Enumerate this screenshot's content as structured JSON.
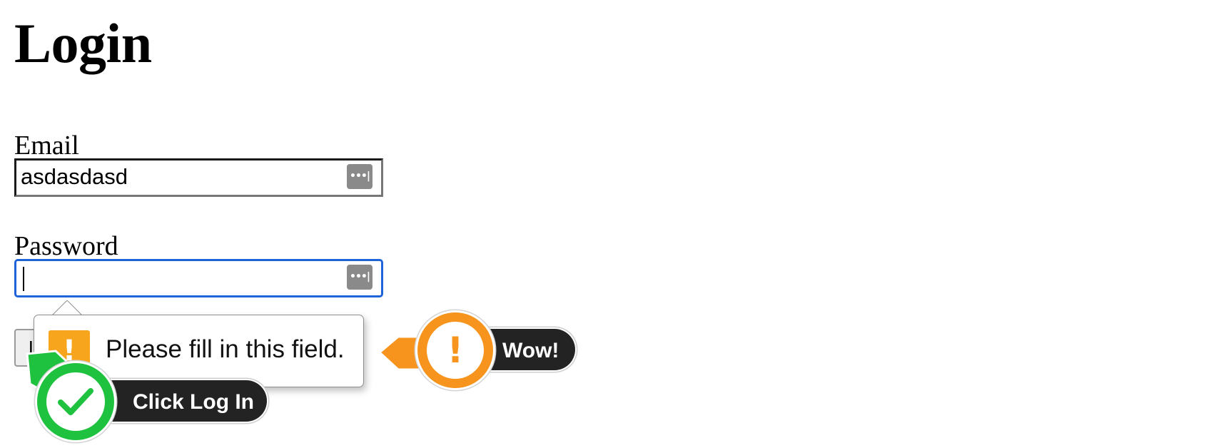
{
  "page": {
    "title": "Login"
  },
  "form": {
    "email": {
      "label": "Email",
      "value": "asdasdasd"
    },
    "password": {
      "label": "Password",
      "value": ""
    },
    "password_manager_icon": "ellipsis-key-icon",
    "submit_label_visible": "L"
  },
  "validation_tooltip": {
    "message": "Please fill in this field.",
    "icon": "warning-icon"
  },
  "annotations": {
    "warning_callout": {
      "label": "Wow!",
      "icon": "exclamation-icon",
      "color": "#f7941d"
    },
    "success_callout": {
      "label": "Click Log In",
      "icon": "checkmark-icon",
      "color": "#1ec23f"
    }
  },
  "colors": {
    "focus_border": "#1f63d8",
    "tooltip_icon": "#f7a51d",
    "callout_pill": "#232323"
  }
}
